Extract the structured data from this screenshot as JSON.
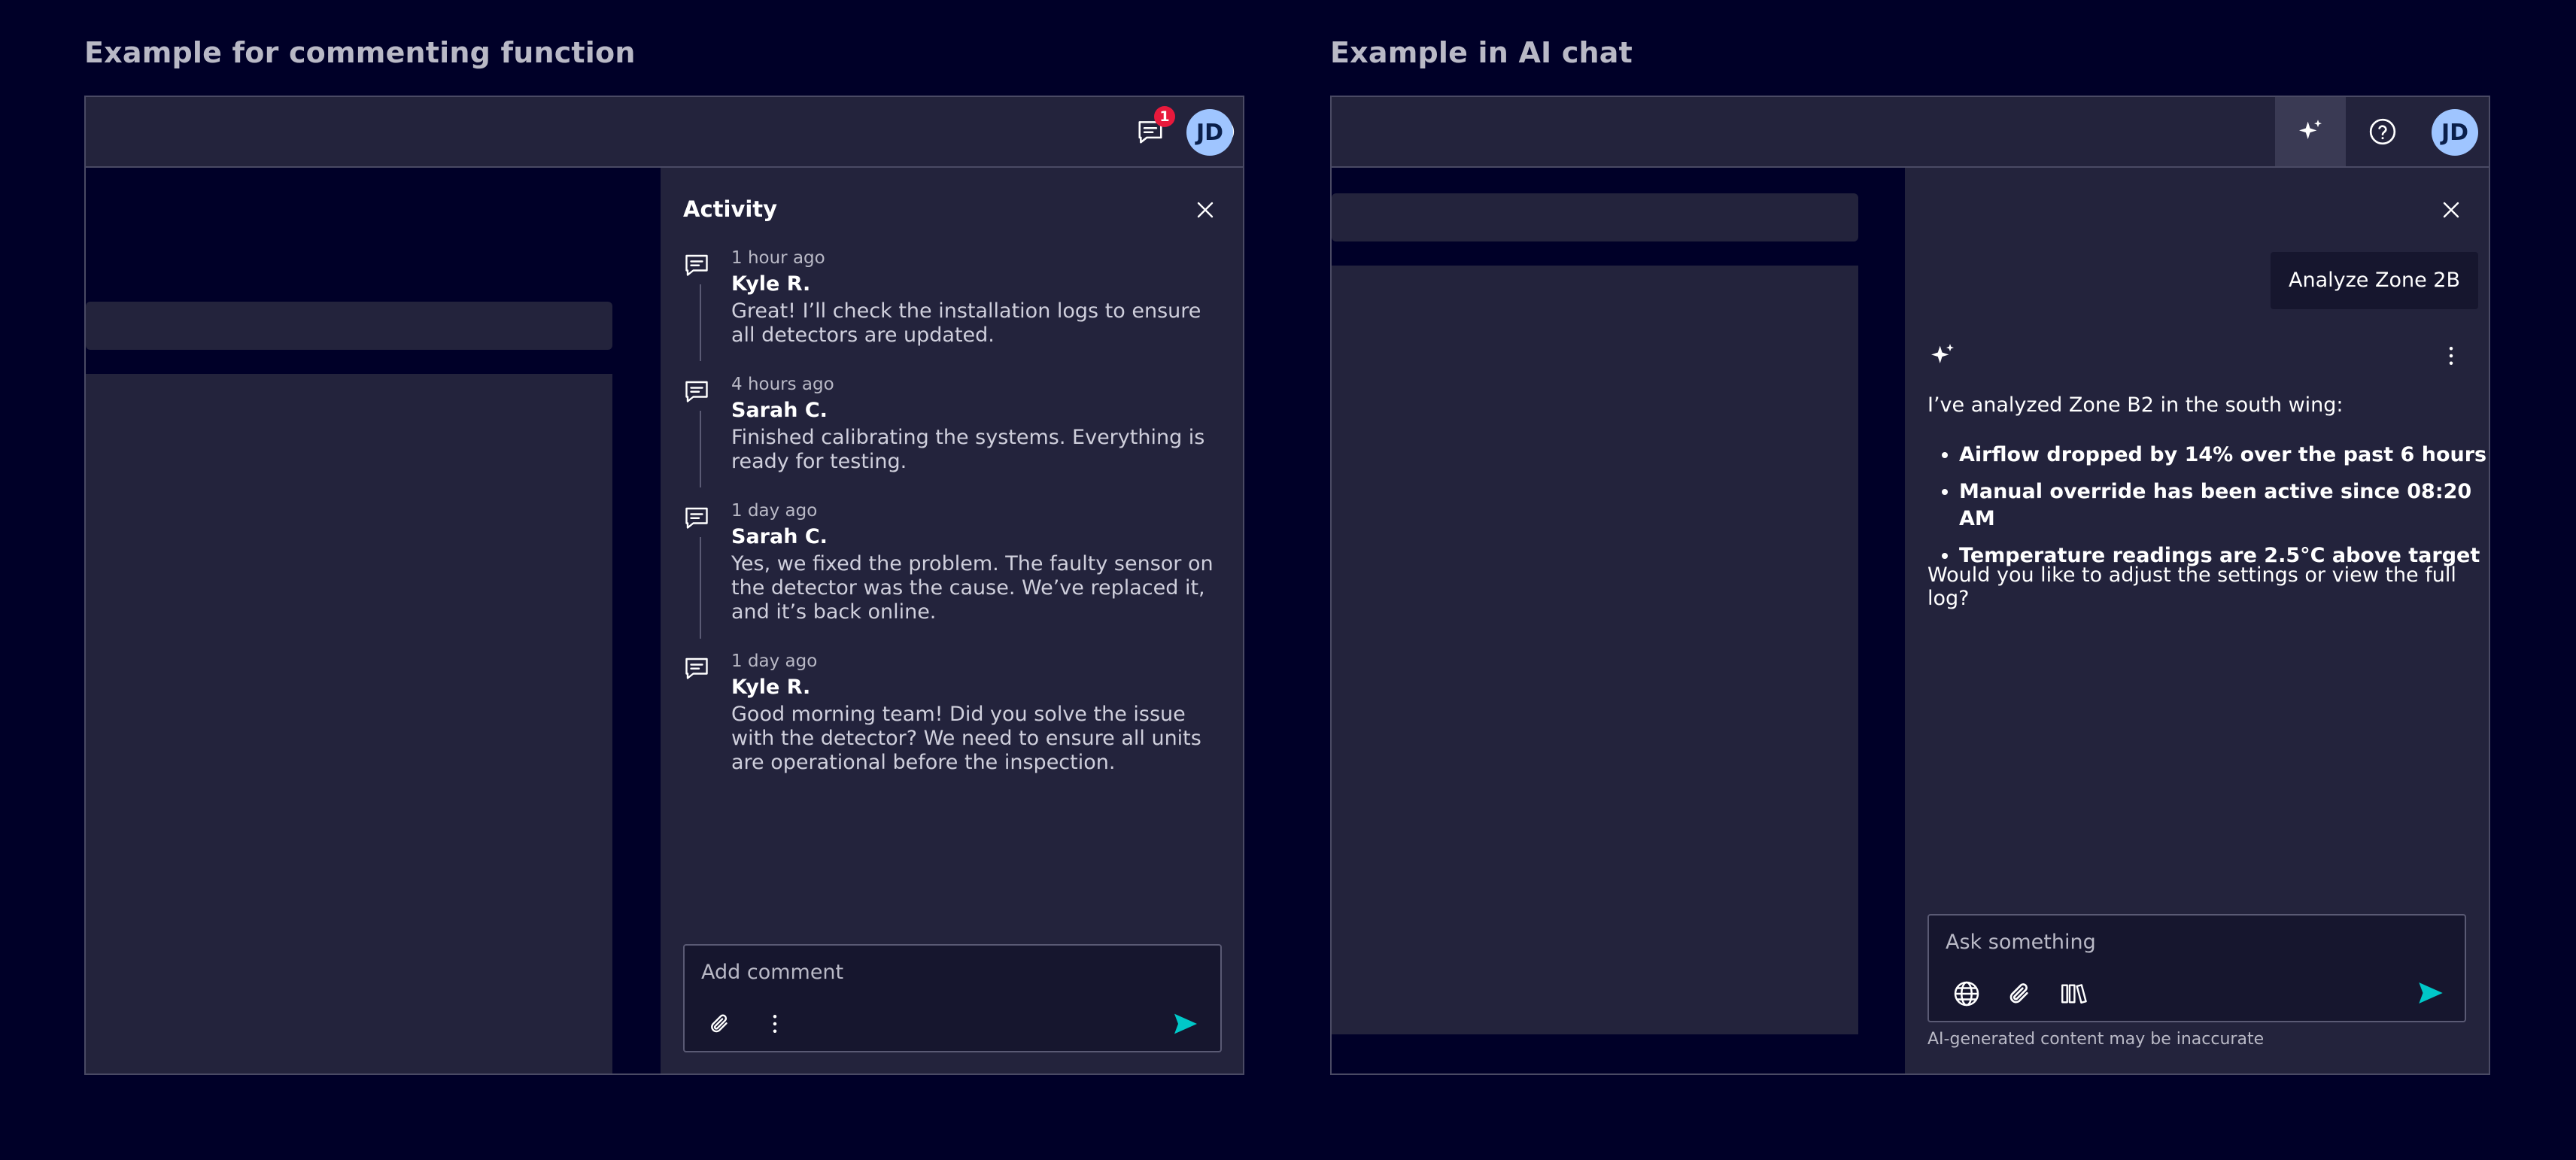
{
  "left": {
    "section_title": "Example for commenting function",
    "topbar": {
      "comments_badge": "1",
      "avatar_initials": "JD"
    },
    "activity": {
      "title": "Activity",
      "items": [
        {
          "time": "1 hour ago",
          "author": "Kyle R.",
          "text": "Great! I’ll check the installation logs to ensure all detectors are updated."
        },
        {
          "time": "4 hours ago",
          "author": "Sarah C.",
          "text": "Finished calibrating the systems. Everything is ready for testing."
        },
        {
          "time": "1 day ago",
          "author": "Sarah C.",
          "text": "Yes, we fixed the problem. The faulty sensor on the detector was the cause. We’ve replaced it, and it’s back online."
        },
        {
          "time": "1 day ago",
          "author": "Kyle R.",
          "text": "Good morning team! Did you solve the issue with the detector? We need to ensure all units are operational before the inspection."
        }
      ],
      "comment_placeholder": "Add comment"
    }
  },
  "right": {
    "section_title": "Example in AI chat",
    "topbar": {
      "avatar_initials": "JD"
    },
    "chat": {
      "user_message": "Analyze Zone 2B",
      "ai_intro": "I’ve analyzed Zone B2 in the south wing:",
      "ai_points": [
        "Airflow dropped by 14% over the past 6 hours",
        "Manual override has been active since 08:20 AM",
        "Temperature readings are 2.5°C above target"
      ],
      "ai_question": "Would you like to adjust the settings or view the full log?",
      "input_placeholder": "Ask something",
      "disclaimer": "AI-generated content may be inaccurate"
    }
  },
  "colors": {
    "background": "#000028",
    "surface": "#23233c",
    "accent": "#00c8c8",
    "badge": "#e8193c",
    "avatar": "#9fc5ff"
  }
}
